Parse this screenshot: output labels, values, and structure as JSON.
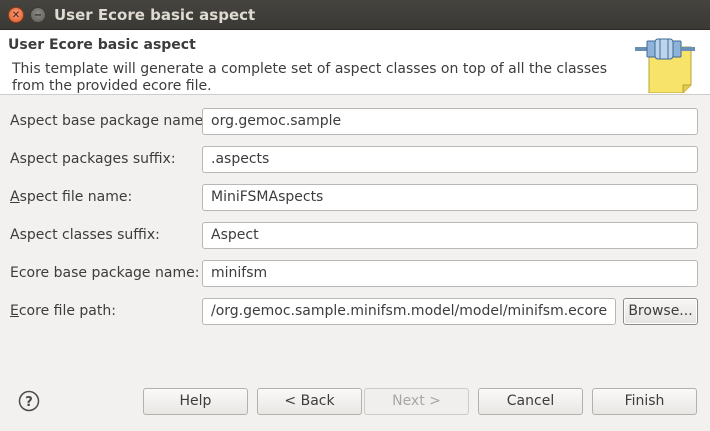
{
  "window": {
    "title": "User Ecore basic aspect",
    "close_glyph": "✕",
    "minimize_glyph": "−"
  },
  "banner": {
    "title": "User Ecore basic aspect",
    "description": "This template will generate a complete set of aspect classes on top of all the classes from the provided ecore file.",
    "icon": "wizard-plug-icon"
  },
  "form": {
    "aspect_base_package": {
      "label": "Aspect base package name:",
      "value": "org.gemoc.sample"
    },
    "aspect_packages_suffix": {
      "label": "Aspect packages suffix:",
      "value": ".aspects"
    },
    "aspect_file_name": {
      "label_mnemonic": "A",
      "label_rest": "spect file name:",
      "value": "MiniFSMAspects"
    },
    "aspect_classes_suffix": {
      "label": "Aspect classes suffix:",
      "value": "Aspect"
    },
    "ecore_base_package": {
      "label": "Ecore base package name:",
      "value": "minifsm"
    },
    "ecore_file_path": {
      "label_mnemonic": "E",
      "label_rest": "core file path:",
      "value": "/org.gemoc.sample.minifsm.model/model/minifsm.ecore"
    },
    "browse_label": "Browse..."
  },
  "buttons": {
    "help_icon": "help-icon",
    "help": "Help",
    "back": "< Back",
    "next": "Next >",
    "cancel": "Cancel",
    "finish": "Finish"
  }
}
